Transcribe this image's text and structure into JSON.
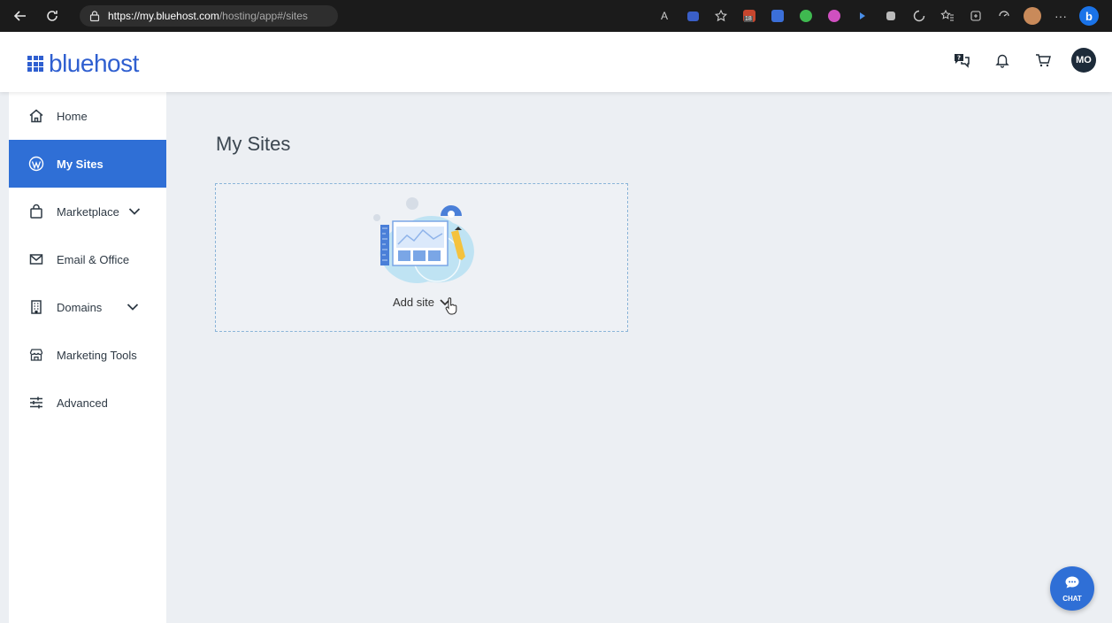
{
  "browser": {
    "url_host": "https://my.bluehost.com",
    "url_path": "/hosting/app#/sites",
    "extension_badge": "18"
  },
  "header": {
    "logo_text": "bluehost",
    "avatar_initials": "MO"
  },
  "sidebar": {
    "items": [
      {
        "label": "Home",
        "icon": "home-icon"
      },
      {
        "label": "My Sites",
        "icon": "wordpress-icon",
        "active": true
      },
      {
        "label": "Marketplace",
        "icon": "bag-icon",
        "has_chevron": true
      },
      {
        "label": "Email & Office",
        "icon": "mail-icon"
      },
      {
        "label": "Domains",
        "icon": "building-icon",
        "has_chevron": true
      },
      {
        "label": "Marketing Tools",
        "icon": "storefront-icon"
      },
      {
        "label": "Advanced",
        "icon": "sliders-icon"
      }
    ]
  },
  "main": {
    "title": "My Sites",
    "add_site_label": "Add site"
  },
  "chat": {
    "label": "CHAT"
  },
  "colors": {
    "brand": "#2f5fd0",
    "active": "#2f6fd6",
    "background": "#eceff3"
  }
}
